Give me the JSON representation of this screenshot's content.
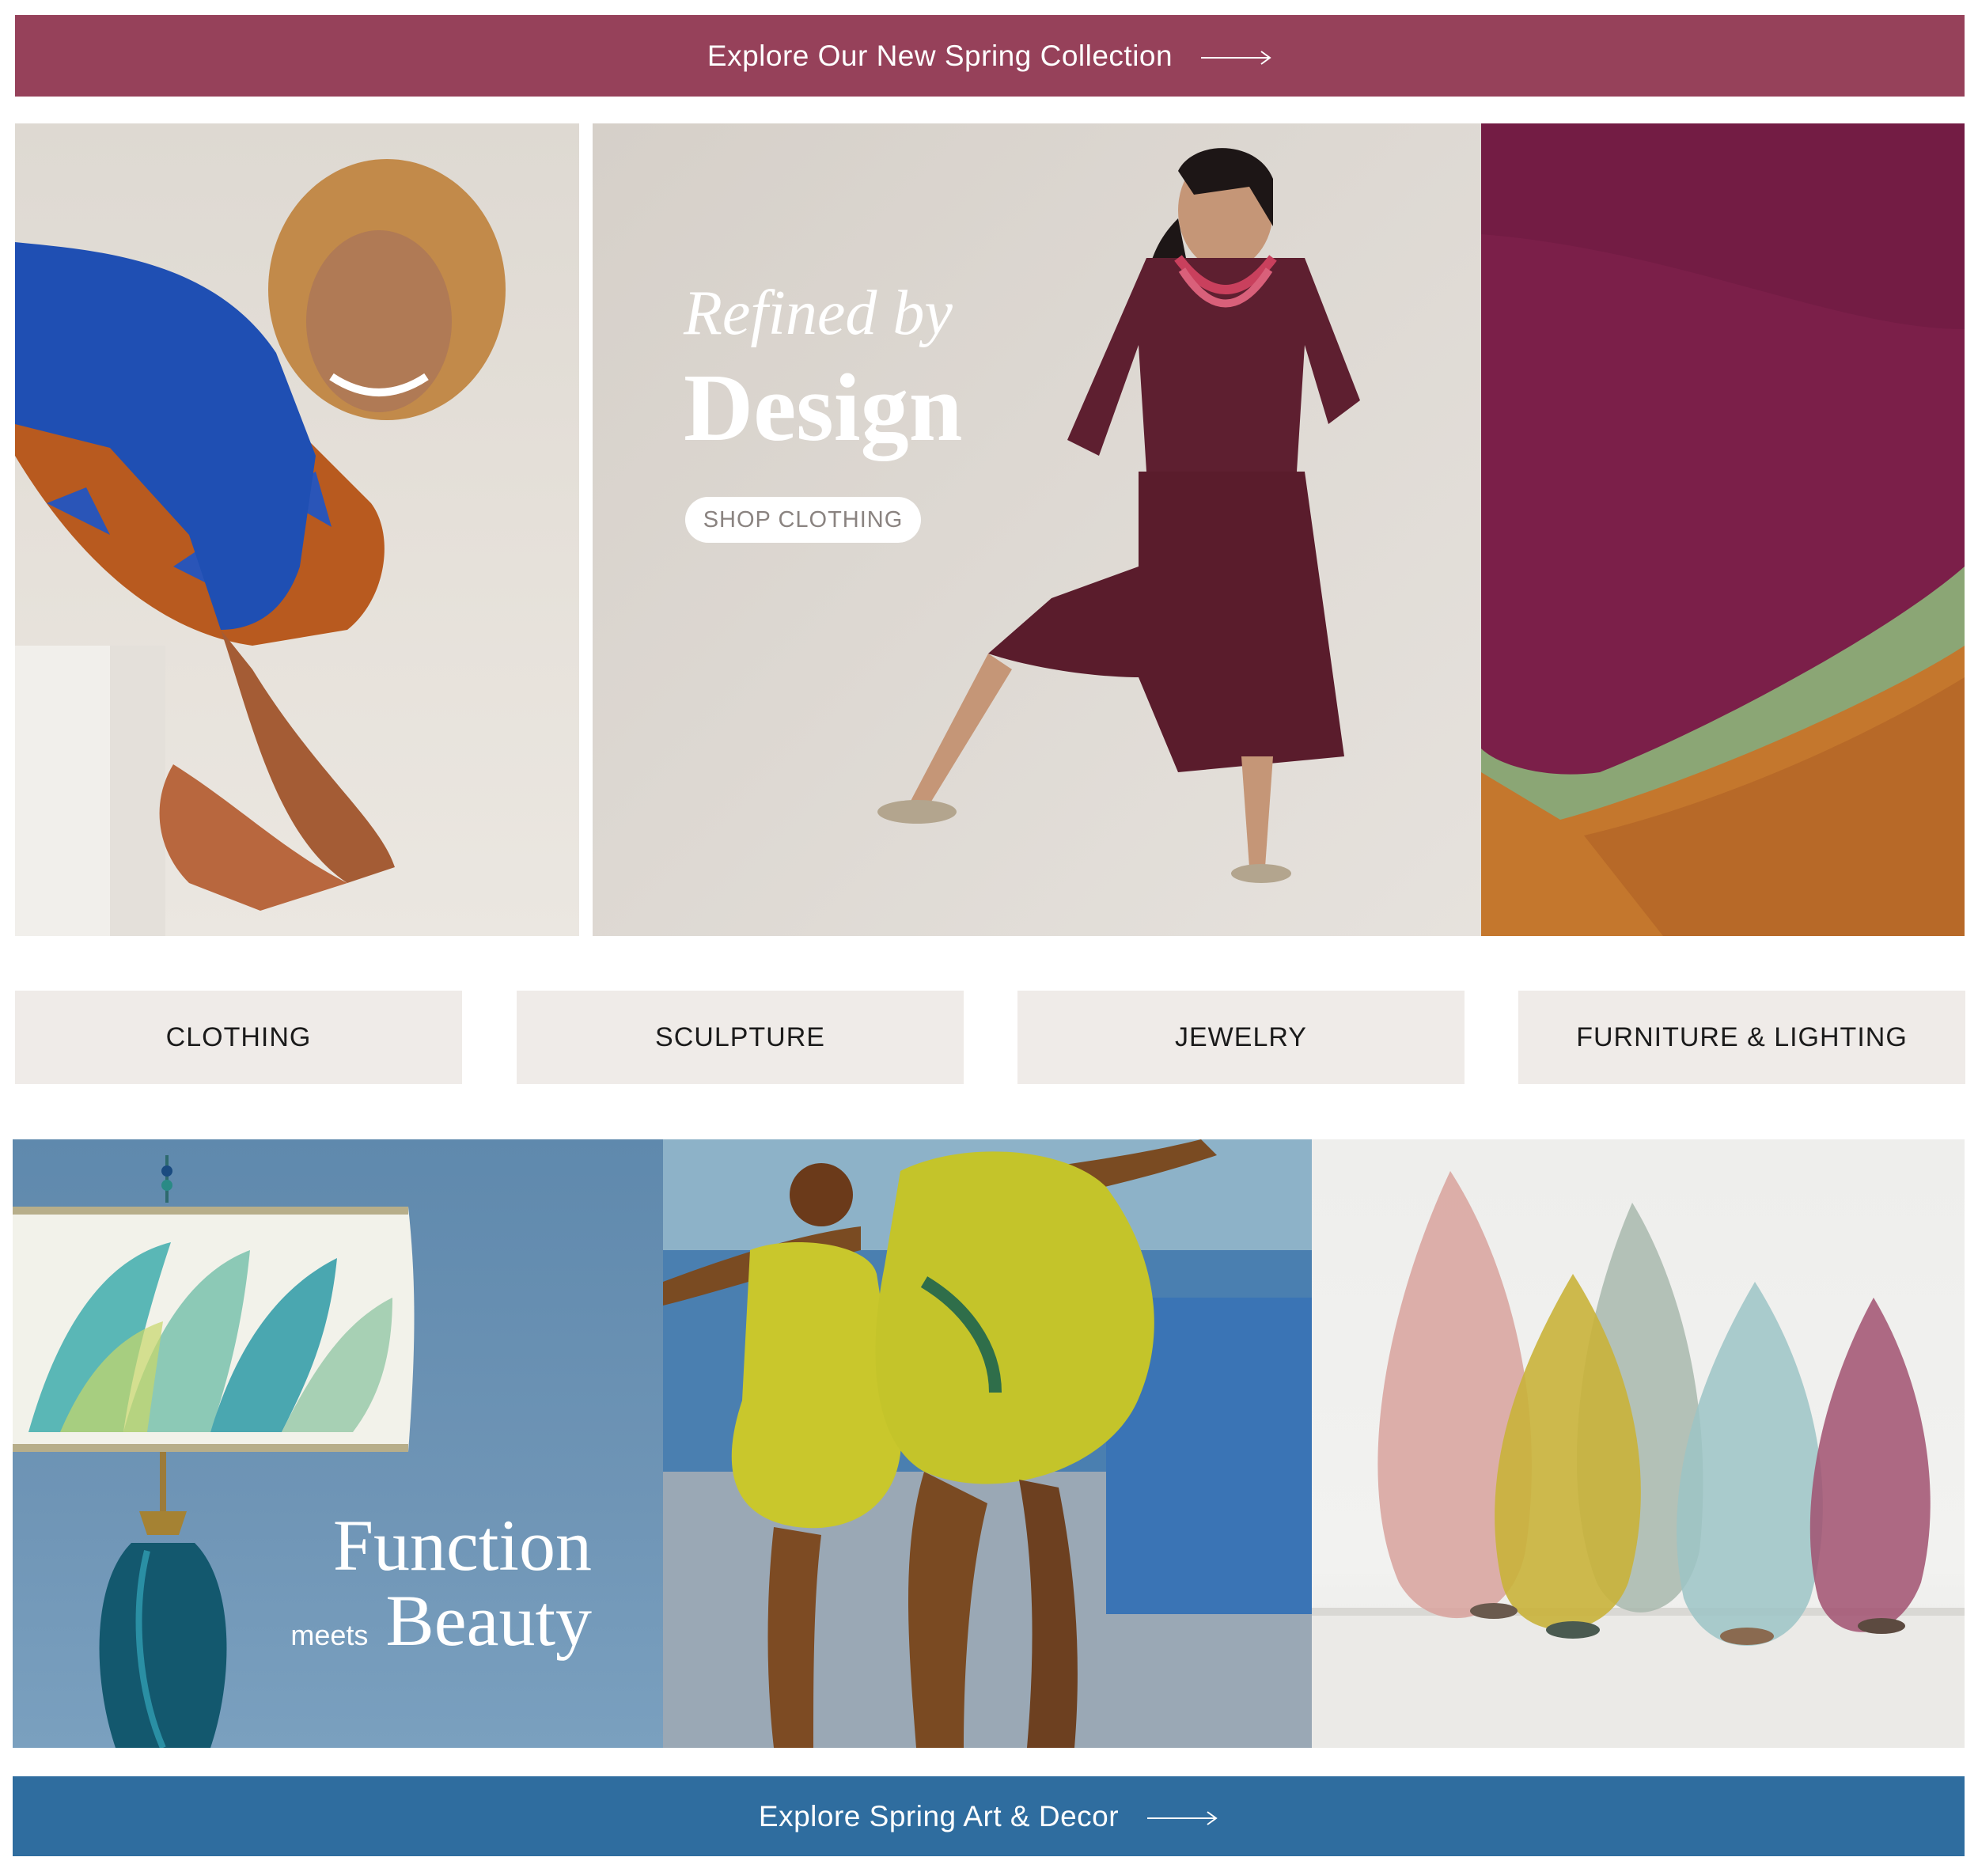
{
  "top_banner": {
    "label": "Explore Our New Spring Collection",
    "arrow": "⟶"
  },
  "hero": {
    "script_line": "Refined by",
    "title": "Design",
    "cta": "SHOP CLOTHING"
  },
  "categories": [
    {
      "label": "CLOTHING"
    },
    {
      "label": "SCULPTURE"
    },
    {
      "label": "JEWELRY"
    },
    {
      "label": "FURNITURE & LIGHTING"
    }
  ],
  "decor": {
    "title": "Function",
    "meets": "meets",
    "subtitle": "Beauty"
  },
  "bottom_banner": {
    "label": "Explore Spring Art & Decor",
    "arrow": "⟶"
  },
  "colors": {
    "top_banner": "#96415a",
    "bottom_banner": "#2f6d9f",
    "category_bg": "#efebe8"
  }
}
